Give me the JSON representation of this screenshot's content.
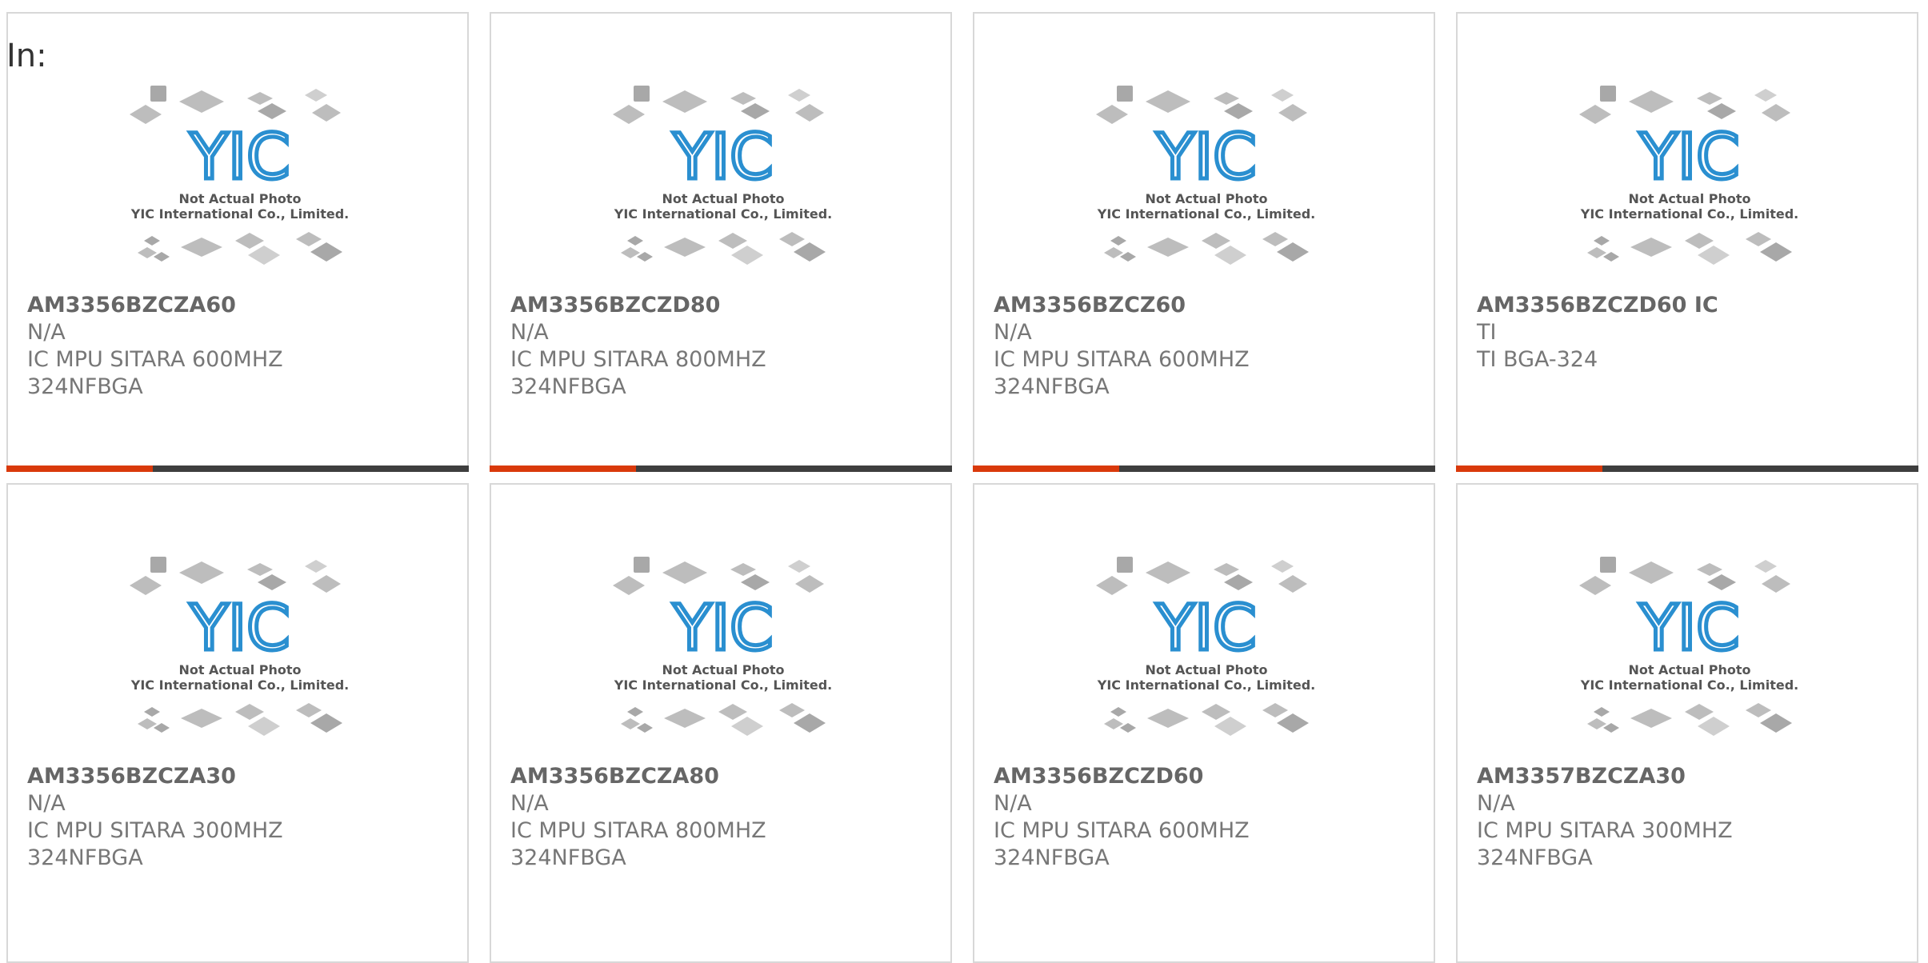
{
  "header": {
    "label": "In:"
  },
  "image_caption": {
    "line1": "Not Actual Photo",
    "line2": "YIC International Co., Limited."
  },
  "brand": {
    "logo_text": "YIC",
    "logo_color": "#2a8fd0"
  },
  "accent_color": "#d9390b",
  "bar_color": "#3e3e3e",
  "products": [
    {
      "name": "AM3356BZCZA60",
      "manufacturer": "N/A",
      "desc1": "IC MPU SITARA 600MHZ",
      "desc2": "324NFBGA"
    },
    {
      "name": "AM3356BZCZD80",
      "manufacturer": "N/A",
      "desc1": "IC MPU SITARA 800MHZ",
      "desc2": "324NFBGA"
    },
    {
      "name": "AM3356BZCZ60",
      "manufacturer": "N/A",
      "desc1": "IC MPU SITARA 600MHZ",
      "desc2": "324NFBGA"
    },
    {
      "name": "AM3356BZCZD60 IC",
      "manufacturer": "TI",
      "desc1": "TI BGA-324",
      "desc2": ""
    },
    {
      "name": "AM3356BZCZA30",
      "manufacturer": "N/A",
      "desc1": "IC MPU SITARA 300MHZ",
      "desc2": "324NFBGA"
    },
    {
      "name": "AM3356BZCZA80",
      "manufacturer": "N/A",
      "desc1": "IC MPU SITARA 800MHZ",
      "desc2": "324NFBGA"
    },
    {
      "name": "AM3356BZCZD60",
      "manufacturer": "N/A",
      "desc1": "IC MPU SITARA 600MHZ",
      "desc2": "324NFBGA"
    },
    {
      "name": "AM3357BZCZA30",
      "manufacturer": "N/A",
      "desc1": "IC MPU SITARA 300MHZ",
      "desc2": "324NFBGA"
    }
  ]
}
